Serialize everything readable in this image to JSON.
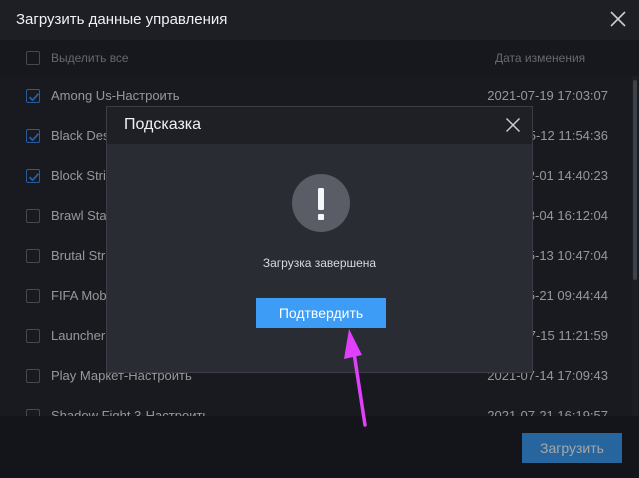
{
  "window": {
    "title": "Загрузить данные управления",
    "close_icon": "close-icon"
  },
  "list_header": {
    "select_all_label": "Выделить все",
    "date_column": "Дата изменения",
    "select_all_checked": false
  },
  "rows": [
    {
      "name": "Among Us-Настроить",
      "date": "2021-07-19 17:03:07",
      "checked": true
    },
    {
      "name": "Black Des",
      "date": "5-12 11:54:36",
      "checked": true
    },
    {
      "name": "Block Stri",
      "date": "2-01 14:40:23",
      "checked": true
    },
    {
      "name": "Brawl Sta",
      "date": "3-04 16:12:04",
      "checked": false
    },
    {
      "name": "Brutal Str",
      "date": "5-13 10:47:04",
      "checked": false
    },
    {
      "name": "FIFA Mob",
      "date": "5-21 09:44:44",
      "checked": false
    },
    {
      "name": "Launcher",
      "date": "7-15 11:21:59",
      "checked": false
    },
    {
      "name": "Play Маркет-Настроить",
      "date": "2021-07-14 17:09:43",
      "checked": false
    },
    {
      "name": "Shadow Fight 3-Настроить",
      "date": "2021-07-21 16:19:57",
      "checked": false
    }
  ],
  "footer": {
    "upload_label": "Загрузить"
  },
  "modal": {
    "title": "Подсказка",
    "message": "Загрузка завершена",
    "confirm_label": "Подтвердить",
    "icon": "exclamation-icon"
  },
  "colors": {
    "accent": "#3d9cf5",
    "annotation_arrow": "#e040fb"
  }
}
